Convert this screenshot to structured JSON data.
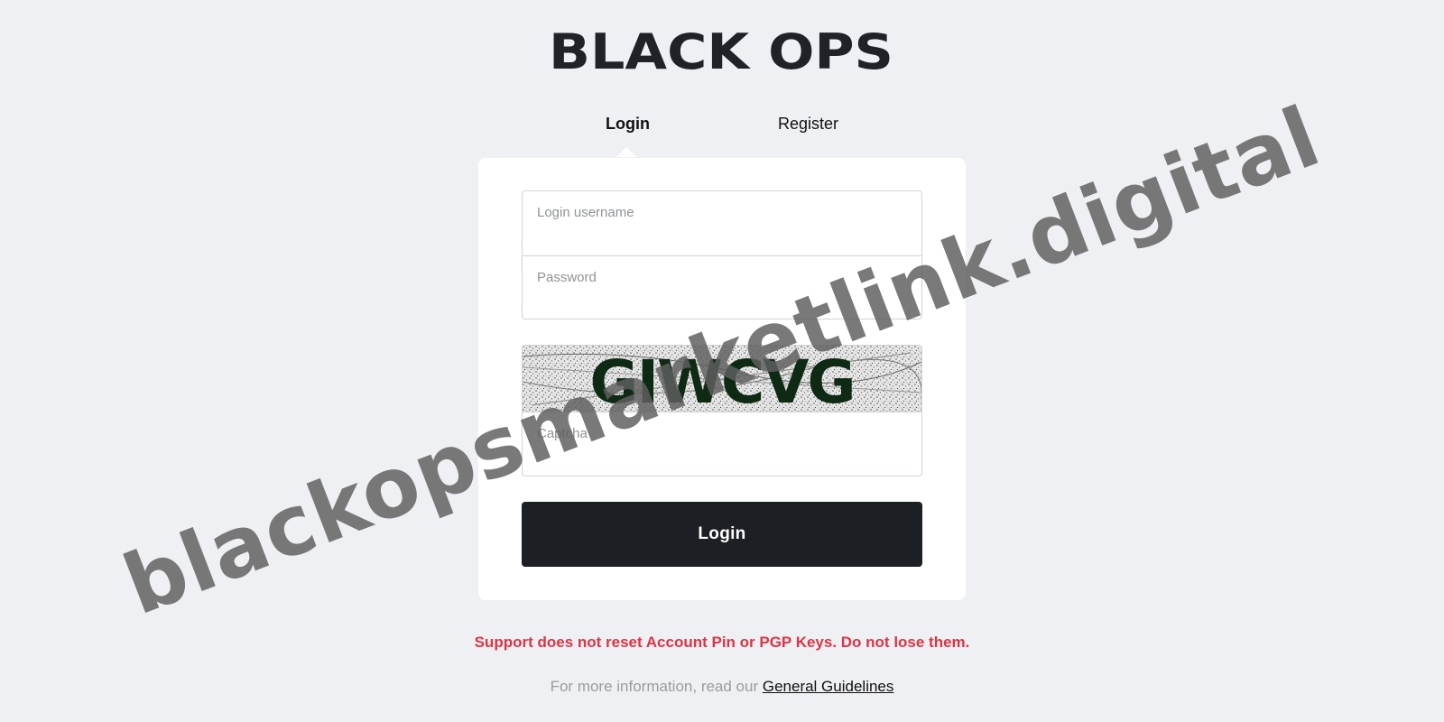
{
  "logo": {
    "text": "BLACK OPS",
    "color_primary": "#1f2227",
    "color_secondary": "#3a3e44"
  },
  "tabs": [
    {
      "label": "Login",
      "active": true
    },
    {
      "label": "Register",
      "active": false
    }
  ],
  "form": {
    "username_placeholder": "Login username",
    "password_placeholder": "Password",
    "captcha_text": "GIWCVG",
    "captcha_placeholder": "Captcha",
    "submit_label": "Login"
  },
  "warning": "Support does not reset Account Pin or PGP Keys. Do not lose them.",
  "info": {
    "prefix": "For more information, read our ",
    "link_label": "General Guidelines"
  },
  "watermark": "blackopsmarketlink.digital",
  "colors": {
    "background": "#eff0f4",
    "card": "#ffffff",
    "button": "#1c1f23",
    "warning": "#dc3545",
    "captcha_text": "#0f2a14"
  }
}
